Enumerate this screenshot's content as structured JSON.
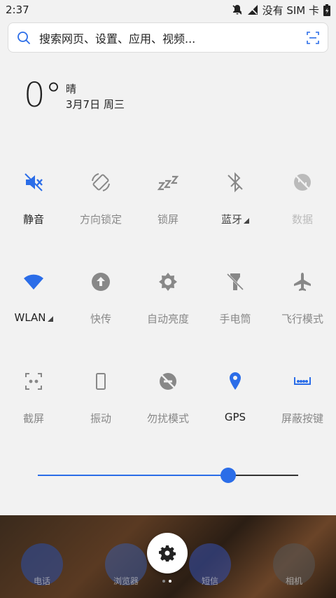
{
  "status_bar": {
    "time": "2:37",
    "carrier": "没有 SIM 卡"
  },
  "search": {
    "placeholder": "搜索网页、设置、应用、视频..."
  },
  "weather": {
    "temperature": "0°",
    "condition": "晴",
    "date": "3月7日 周三"
  },
  "tiles": [
    {
      "label": "静音",
      "icon": "mute-icon",
      "state": "active"
    },
    {
      "label": "方向锁定",
      "icon": "rotation-lock-icon",
      "state": "off"
    },
    {
      "label": "锁屏",
      "icon": "sleep-icon",
      "state": "off"
    },
    {
      "label": "蓝牙",
      "icon": "bluetooth-off-icon",
      "state": "off-expandable"
    },
    {
      "label": "数据",
      "icon": "data-off-icon",
      "state": "disabled"
    },
    {
      "label": "WLAN",
      "icon": "wifi-icon",
      "state": "active-expandable"
    },
    {
      "label": "快传",
      "icon": "upload-icon",
      "state": "off"
    },
    {
      "label": "自动亮度",
      "icon": "brightness-icon",
      "state": "off"
    },
    {
      "label": "手电筒",
      "icon": "flashlight-off-icon",
      "state": "off"
    },
    {
      "label": "飞行模式",
      "icon": "airplane-icon",
      "state": "off"
    },
    {
      "label": "截屏",
      "icon": "screenshot-icon",
      "state": "off"
    },
    {
      "label": "振动",
      "icon": "vibrate-icon",
      "state": "off"
    },
    {
      "label": "勿扰模式",
      "icon": "dnd-icon",
      "state": "off"
    },
    {
      "label": "GPS",
      "icon": "location-icon",
      "state": "active"
    },
    {
      "label": "屏蔽按键",
      "icon": "keyboard-block-icon",
      "state": "active"
    }
  ],
  "brightness": {
    "level": 0.73
  },
  "dock": {
    "apps": [
      "电话",
      "浏览器",
      "短信",
      "相机"
    ]
  },
  "colors": {
    "accent": "#2b6de8",
    "inactive": "#888888",
    "background": "#f2f2f2"
  }
}
